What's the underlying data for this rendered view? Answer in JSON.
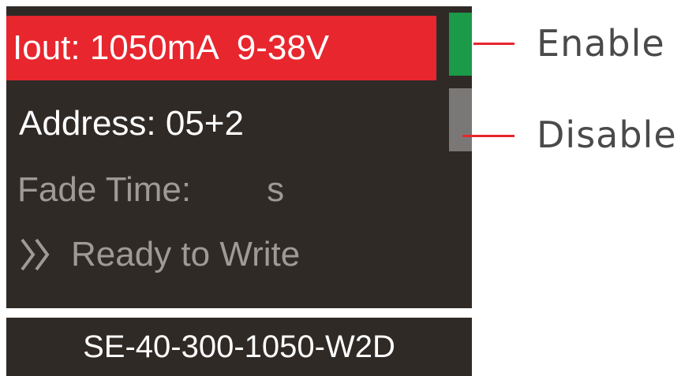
{
  "screen": {
    "iout_label": "Iout: 1050mA",
    "voltage_range": "9-38V",
    "address_label": "Address: 05+2",
    "fade_time_label": "Fade Time:",
    "fade_time_unit": "s",
    "ready_label": "Ready to Write",
    "ready_icon": "double-chevron-right-icon",
    "model": "SE-40-300-1050-W2D"
  },
  "indicators": {
    "enable": {
      "label": "Enable",
      "color": "#1b9a48"
    },
    "disable": {
      "label": "Disable",
      "color": "#7a7876"
    }
  },
  "colors": {
    "highlight": "#e8262e",
    "screen_bg": "#302a27",
    "active_text": "#ffffff",
    "inactive_text": "#9e9a98",
    "callout_line": "#e8262e"
  }
}
